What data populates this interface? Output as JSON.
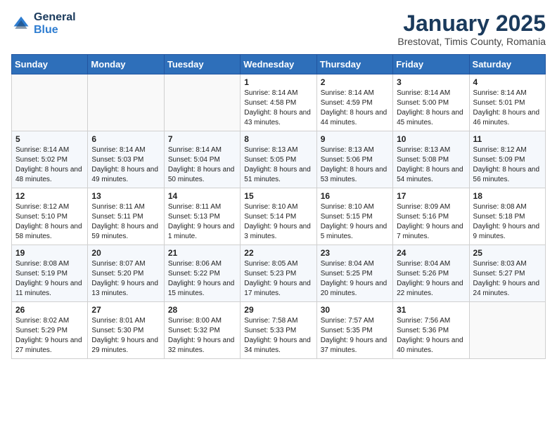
{
  "header": {
    "logo_line1": "General",
    "logo_line2": "Blue",
    "month_year": "January 2025",
    "location": "Brestovat, Timis County, Romania"
  },
  "weekdays": [
    "Sunday",
    "Monday",
    "Tuesday",
    "Wednesday",
    "Thursday",
    "Friday",
    "Saturday"
  ],
  "weeks": [
    [
      {
        "day": "",
        "sunrise": "",
        "sunset": "",
        "daylight": ""
      },
      {
        "day": "",
        "sunrise": "",
        "sunset": "",
        "daylight": ""
      },
      {
        "day": "",
        "sunrise": "",
        "sunset": "",
        "daylight": ""
      },
      {
        "day": "1",
        "sunrise": "Sunrise: 8:14 AM",
        "sunset": "Sunset: 4:58 PM",
        "daylight": "Daylight: 8 hours and 43 minutes."
      },
      {
        "day": "2",
        "sunrise": "Sunrise: 8:14 AM",
        "sunset": "Sunset: 4:59 PM",
        "daylight": "Daylight: 8 hours and 44 minutes."
      },
      {
        "day": "3",
        "sunrise": "Sunrise: 8:14 AM",
        "sunset": "Sunset: 5:00 PM",
        "daylight": "Daylight: 8 hours and 45 minutes."
      },
      {
        "day": "4",
        "sunrise": "Sunrise: 8:14 AM",
        "sunset": "Sunset: 5:01 PM",
        "daylight": "Daylight: 8 hours and 46 minutes."
      }
    ],
    [
      {
        "day": "5",
        "sunrise": "Sunrise: 8:14 AM",
        "sunset": "Sunset: 5:02 PM",
        "daylight": "Daylight: 8 hours and 48 minutes."
      },
      {
        "day": "6",
        "sunrise": "Sunrise: 8:14 AM",
        "sunset": "Sunset: 5:03 PM",
        "daylight": "Daylight: 8 hours and 49 minutes."
      },
      {
        "day": "7",
        "sunrise": "Sunrise: 8:14 AM",
        "sunset": "Sunset: 5:04 PM",
        "daylight": "Daylight: 8 hours and 50 minutes."
      },
      {
        "day": "8",
        "sunrise": "Sunrise: 8:13 AM",
        "sunset": "Sunset: 5:05 PM",
        "daylight": "Daylight: 8 hours and 51 minutes."
      },
      {
        "day": "9",
        "sunrise": "Sunrise: 8:13 AM",
        "sunset": "Sunset: 5:06 PM",
        "daylight": "Daylight: 8 hours and 53 minutes."
      },
      {
        "day": "10",
        "sunrise": "Sunrise: 8:13 AM",
        "sunset": "Sunset: 5:08 PM",
        "daylight": "Daylight: 8 hours and 54 minutes."
      },
      {
        "day": "11",
        "sunrise": "Sunrise: 8:12 AM",
        "sunset": "Sunset: 5:09 PM",
        "daylight": "Daylight: 8 hours and 56 minutes."
      }
    ],
    [
      {
        "day": "12",
        "sunrise": "Sunrise: 8:12 AM",
        "sunset": "Sunset: 5:10 PM",
        "daylight": "Daylight: 8 hours and 58 minutes."
      },
      {
        "day": "13",
        "sunrise": "Sunrise: 8:11 AM",
        "sunset": "Sunset: 5:11 PM",
        "daylight": "Daylight: 8 hours and 59 minutes."
      },
      {
        "day": "14",
        "sunrise": "Sunrise: 8:11 AM",
        "sunset": "Sunset: 5:13 PM",
        "daylight": "Daylight: 9 hours and 1 minute."
      },
      {
        "day": "15",
        "sunrise": "Sunrise: 8:10 AM",
        "sunset": "Sunset: 5:14 PM",
        "daylight": "Daylight: 9 hours and 3 minutes."
      },
      {
        "day": "16",
        "sunrise": "Sunrise: 8:10 AM",
        "sunset": "Sunset: 5:15 PM",
        "daylight": "Daylight: 9 hours and 5 minutes."
      },
      {
        "day": "17",
        "sunrise": "Sunrise: 8:09 AM",
        "sunset": "Sunset: 5:16 PM",
        "daylight": "Daylight: 9 hours and 7 minutes."
      },
      {
        "day": "18",
        "sunrise": "Sunrise: 8:08 AM",
        "sunset": "Sunset: 5:18 PM",
        "daylight": "Daylight: 9 hours and 9 minutes."
      }
    ],
    [
      {
        "day": "19",
        "sunrise": "Sunrise: 8:08 AM",
        "sunset": "Sunset: 5:19 PM",
        "daylight": "Daylight: 9 hours and 11 minutes."
      },
      {
        "day": "20",
        "sunrise": "Sunrise: 8:07 AM",
        "sunset": "Sunset: 5:20 PM",
        "daylight": "Daylight: 9 hours and 13 minutes."
      },
      {
        "day": "21",
        "sunrise": "Sunrise: 8:06 AM",
        "sunset": "Sunset: 5:22 PM",
        "daylight": "Daylight: 9 hours and 15 minutes."
      },
      {
        "day": "22",
        "sunrise": "Sunrise: 8:05 AM",
        "sunset": "Sunset: 5:23 PM",
        "daylight": "Daylight: 9 hours and 17 minutes."
      },
      {
        "day": "23",
        "sunrise": "Sunrise: 8:04 AM",
        "sunset": "Sunset: 5:25 PM",
        "daylight": "Daylight: 9 hours and 20 minutes."
      },
      {
        "day": "24",
        "sunrise": "Sunrise: 8:04 AM",
        "sunset": "Sunset: 5:26 PM",
        "daylight": "Daylight: 9 hours and 22 minutes."
      },
      {
        "day": "25",
        "sunrise": "Sunrise: 8:03 AM",
        "sunset": "Sunset: 5:27 PM",
        "daylight": "Daylight: 9 hours and 24 minutes."
      }
    ],
    [
      {
        "day": "26",
        "sunrise": "Sunrise: 8:02 AM",
        "sunset": "Sunset: 5:29 PM",
        "daylight": "Daylight: 9 hours and 27 minutes."
      },
      {
        "day": "27",
        "sunrise": "Sunrise: 8:01 AM",
        "sunset": "Sunset: 5:30 PM",
        "daylight": "Daylight: 9 hours and 29 minutes."
      },
      {
        "day": "28",
        "sunrise": "Sunrise: 8:00 AM",
        "sunset": "Sunset: 5:32 PM",
        "daylight": "Daylight: 9 hours and 32 minutes."
      },
      {
        "day": "29",
        "sunrise": "Sunrise: 7:58 AM",
        "sunset": "Sunset: 5:33 PM",
        "daylight": "Daylight: 9 hours and 34 minutes."
      },
      {
        "day": "30",
        "sunrise": "Sunrise: 7:57 AM",
        "sunset": "Sunset: 5:35 PM",
        "daylight": "Daylight: 9 hours and 37 minutes."
      },
      {
        "day": "31",
        "sunrise": "Sunrise: 7:56 AM",
        "sunset": "Sunset: 5:36 PM",
        "daylight": "Daylight: 9 hours and 40 minutes."
      },
      {
        "day": "",
        "sunrise": "",
        "sunset": "",
        "daylight": ""
      }
    ]
  ]
}
